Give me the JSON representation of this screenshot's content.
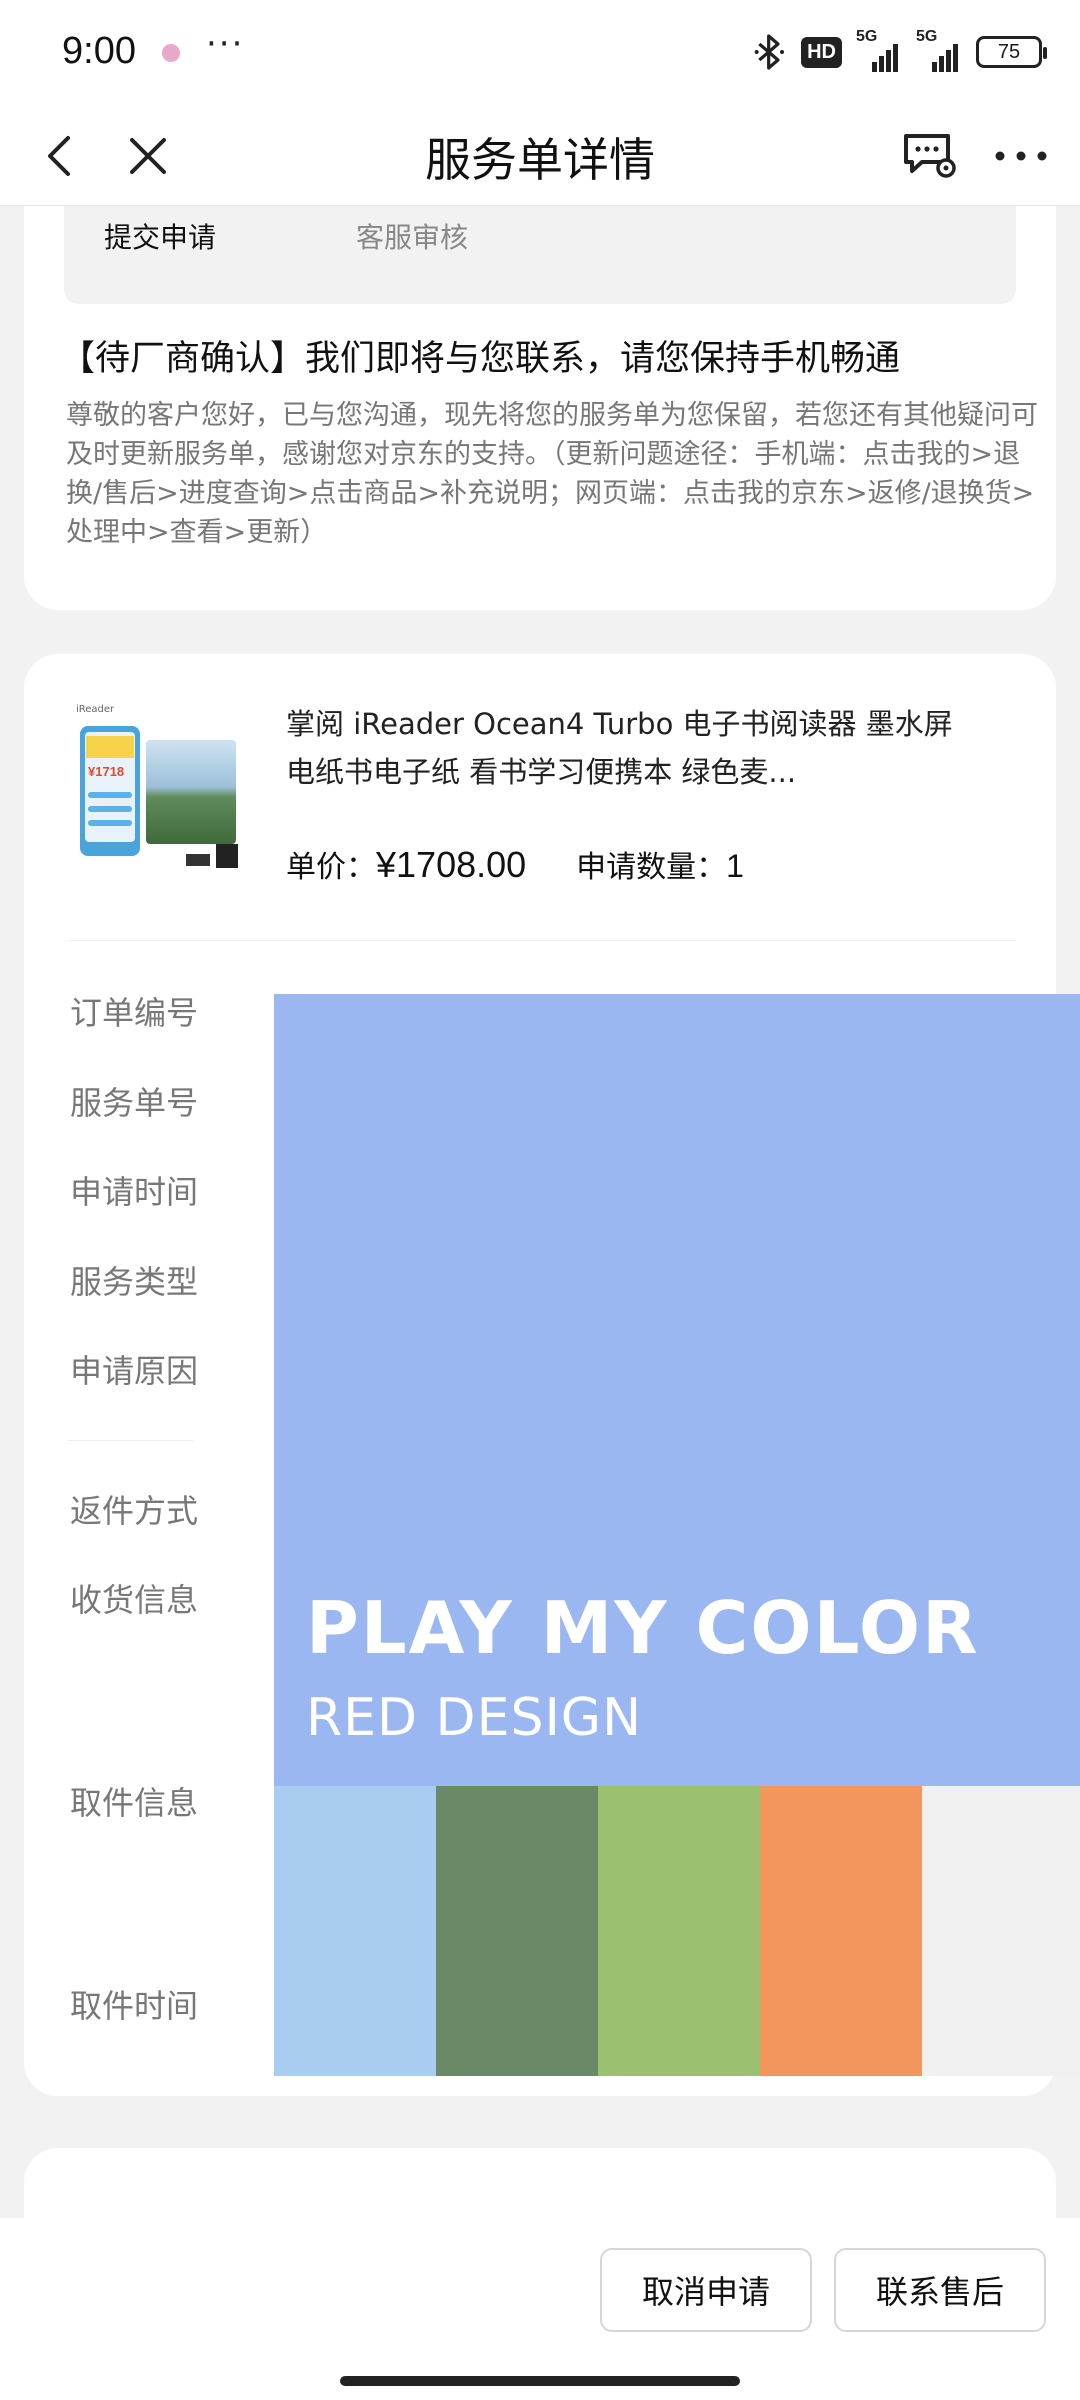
{
  "status_bar": {
    "time": "9:00",
    "more": "···",
    "hd_badge": "HD",
    "signal1_label": "5G",
    "signal2_label": "5G",
    "battery": "75"
  },
  "nav": {
    "title": "服务单详情"
  },
  "progress": {
    "step1": "提交申请",
    "step2": "客服审核"
  },
  "notice": {
    "title": "【待厂商确认】我们即将与您联系，请您保持手机畅通",
    "body": "尊敬的客户您好，已与您沟通，现先将您的服务单为您保留，若您还有其他疑问可及时更新服务单，感谢您对京东的支持。（更新问题途径：手机端：点击我的>退换/售后>进度查询>点击商品>补充说明；网页端：点击我的京东>返修/退换货>处理中>查看>更新）"
  },
  "product": {
    "name": "掌阅 iReader Ocean4 Turbo 电子书阅读器 墨水屏电纸书电子纸 看书学习便携本 绿色麦...",
    "price_label": "单价：",
    "price": "¥1708.00",
    "qty_label": "申请数量：",
    "qty": "1",
    "image_brand": "iReader",
    "image_price": "¥1718"
  },
  "fields": {
    "order_no": "订单编号",
    "service_no": "服务单号",
    "apply_time": "申请时间",
    "service_type": "服务类型",
    "apply_reason": "申请原因",
    "return_method": "返件方式",
    "receive_info": "收货信息",
    "pickup_info": "取件信息",
    "pickup_time": "取件时间"
  },
  "overlay": {
    "title": "PLAY MY COLOR",
    "subtitle": "RED DESIGN",
    "colors": [
      "#9bb7f1",
      "#a9cdf1",
      "#6a8a67",
      "#9ac070",
      "#f2965e",
      "#f0f0f0"
    ]
  },
  "buttons": {
    "cancel": "取消申请",
    "contact": "联系售后"
  }
}
